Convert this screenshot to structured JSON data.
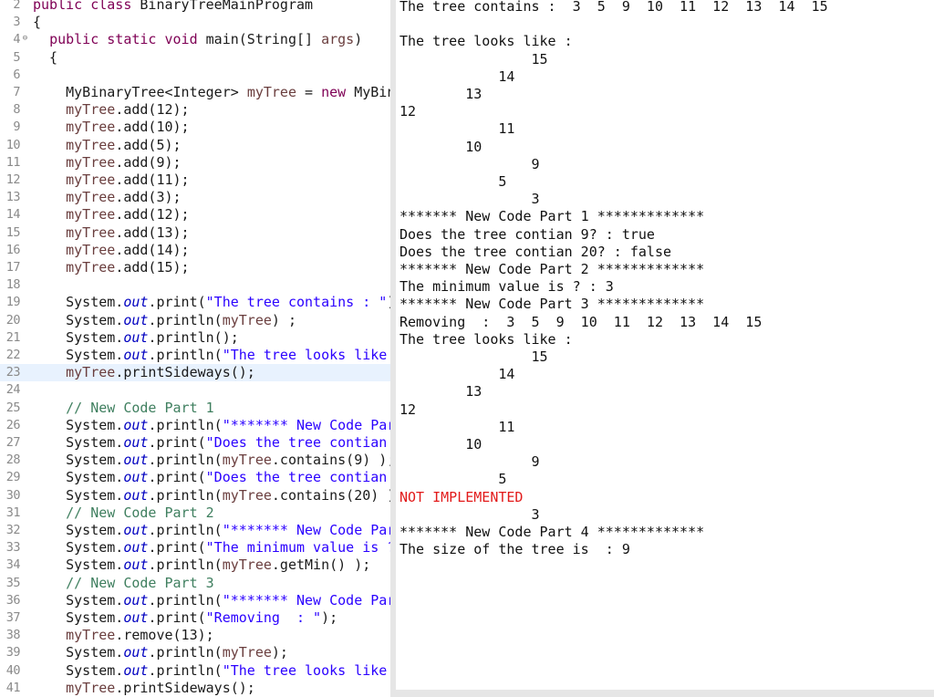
{
  "editor": {
    "lines": [
      {
        "n": "2",
        "tokens": [
          {
            "t": "kw",
            "v": "public"
          },
          {
            "t": "",
            "v": " "
          },
          {
            "t": "kw",
            "v": "class"
          },
          {
            "t": "",
            "v": " BinaryTreeMainProgram"
          }
        ]
      },
      {
        "n": "3",
        "tokens": [
          {
            "t": "",
            "v": "{"
          }
        ]
      },
      {
        "n": "4",
        "fold": true,
        "tokens": [
          {
            "t": "",
            "v": "  "
          },
          {
            "t": "kw",
            "v": "public"
          },
          {
            "t": "",
            "v": " "
          },
          {
            "t": "kw",
            "v": "static"
          },
          {
            "t": "",
            "v": " "
          },
          {
            "t": "kw",
            "v": "void"
          },
          {
            "t": "",
            "v": " main(String[] "
          },
          {
            "t": "var",
            "v": "args"
          },
          {
            "t": "",
            "v": ")"
          }
        ]
      },
      {
        "n": "5",
        "tokens": [
          {
            "t": "",
            "v": "  {"
          }
        ]
      },
      {
        "n": "6",
        "tokens": []
      },
      {
        "n": "7",
        "tokens": [
          {
            "t": "",
            "v": "    MyBinaryTree<Integer> "
          },
          {
            "t": "var",
            "v": "myTree"
          },
          {
            "t": "",
            "v": " = "
          },
          {
            "t": "kw",
            "v": "new"
          },
          {
            "t": "",
            "v": " MyBin"
          }
        ]
      },
      {
        "n": "8",
        "tokens": [
          {
            "t": "",
            "v": "    "
          },
          {
            "t": "var",
            "v": "myTree"
          },
          {
            "t": "",
            "v": ".add(12);"
          }
        ]
      },
      {
        "n": "9",
        "tokens": [
          {
            "t": "",
            "v": "    "
          },
          {
            "t": "var",
            "v": "myTree"
          },
          {
            "t": "",
            "v": ".add(10);"
          }
        ]
      },
      {
        "n": "10",
        "tokens": [
          {
            "t": "",
            "v": "    "
          },
          {
            "t": "var",
            "v": "myTree"
          },
          {
            "t": "",
            "v": ".add(5);"
          }
        ]
      },
      {
        "n": "11",
        "tokens": [
          {
            "t": "",
            "v": "    "
          },
          {
            "t": "var",
            "v": "myTree"
          },
          {
            "t": "",
            "v": ".add(9);"
          }
        ]
      },
      {
        "n": "12",
        "tokens": [
          {
            "t": "",
            "v": "    "
          },
          {
            "t": "var",
            "v": "myTree"
          },
          {
            "t": "",
            "v": ".add(11);"
          }
        ]
      },
      {
        "n": "13",
        "tokens": [
          {
            "t": "",
            "v": "    "
          },
          {
            "t": "var",
            "v": "myTree"
          },
          {
            "t": "",
            "v": ".add(3);"
          }
        ]
      },
      {
        "n": "14",
        "tokens": [
          {
            "t": "",
            "v": "    "
          },
          {
            "t": "var",
            "v": "myTree"
          },
          {
            "t": "",
            "v": ".add(12);"
          }
        ]
      },
      {
        "n": "15",
        "tokens": [
          {
            "t": "",
            "v": "    "
          },
          {
            "t": "var",
            "v": "myTree"
          },
          {
            "t": "",
            "v": ".add(13);"
          }
        ]
      },
      {
        "n": "16",
        "tokens": [
          {
            "t": "",
            "v": "    "
          },
          {
            "t": "var",
            "v": "myTree"
          },
          {
            "t": "",
            "v": ".add(14);"
          }
        ]
      },
      {
        "n": "17",
        "tokens": [
          {
            "t": "",
            "v": "    "
          },
          {
            "t": "var",
            "v": "myTree"
          },
          {
            "t": "",
            "v": ".add(15);"
          }
        ]
      },
      {
        "n": "18",
        "tokens": []
      },
      {
        "n": "19",
        "tokens": [
          {
            "t": "",
            "v": "    System."
          },
          {
            "t": "fld",
            "v": "out"
          },
          {
            "t": "",
            "v": ".print("
          },
          {
            "t": "str",
            "v": "\"The tree contains : \""
          },
          {
            "t": "",
            "v": ")"
          }
        ]
      },
      {
        "n": "20",
        "tokens": [
          {
            "t": "",
            "v": "    System."
          },
          {
            "t": "fld",
            "v": "out"
          },
          {
            "t": "",
            "v": ".println("
          },
          {
            "t": "var",
            "v": "myTree"
          },
          {
            "t": "",
            "v": ") ;"
          }
        ]
      },
      {
        "n": "21",
        "tokens": [
          {
            "t": "",
            "v": "    System."
          },
          {
            "t": "fld",
            "v": "out"
          },
          {
            "t": "",
            "v": ".println();"
          }
        ]
      },
      {
        "n": "22",
        "tokens": [
          {
            "t": "",
            "v": "    System."
          },
          {
            "t": "fld",
            "v": "out"
          },
          {
            "t": "",
            "v": ".println("
          },
          {
            "t": "str",
            "v": "\"The tree looks like"
          }
        ]
      },
      {
        "n": "23",
        "active": true,
        "tokens": [
          {
            "t": "",
            "v": "    "
          },
          {
            "t": "var",
            "v": "myTree"
          },
          {
            "t": "",
            "v": ".printSideways();"
          }
        ]
      },
      {
        "n": "24",
        "tokens": []
      },
      {
        "n": "25",
        "tokens": [
          {
            "t": "",
            "v": "    "
          },
          {
            "t": "com",
            "v": "// New Code Part 1"
          }
        ]
      },
      {
        "n": "26",
        "tokens": [
          {
            "t": "",
            "v": "    System."
          },
          {
            "t": "fld",
            "v": "out"
          },
          {
            "t": "",
            "v": ".println("
          },
          {
            "t": "str",
            "v": "\"******* New Code Par"
          }
        ]
      },
      {
        "n": "27",
        "tokens": [
          {
            "t": "",
            "v": "    System."
          },
          {
            "t": "fld",
            "v": "out"
          },
          {
            "t": "",
            "v": ".print("
          },
          {
            "t": "str",
            "v": "\"Does the tree contian '"
          }
        ]
      },
      {
        "n": "28",
        "tokens": [
          {
            "t": "",
            "v": "    System."
          },
          {
            "t": "fld",
            "v": "out"
          },
          {
            "t": "",
            "v": ".println("
          },
          {
            "t": "var",
            "v": "myTree"
          },
          {
            "t": "",
            "v": ".contains(9) );"
          }
        ]
      },
      {
        "n": "29",
        "tokens": [
          {
            "t": "",
            "v": "    System."
          },
          {
            "t": "fld",
            "v": "out"
          },
          {
            "t": "",
            "v": ".print("
          },
          {
            "t": "str",
            "v": "\"Does the tree contian :"
          }
        ]
      },
      {
        "n": "30",
        "tokens": [
          {
            "t": "",
            "v": "    System."
          },
          {
            "t": "fld",
            "v": "out"
          },
          {
            "t": "",
            "v": ".println("
          },
          {
            "t": "var",
            "v": "myTree"
          },
          {
            "t": "",
            "v": ".contains(20) )"
          }
        ]
      },
      {
        "n": "31",
        "tokens": [
          {
            "t": "",
            "v": "    "
          },
          {
            "t": "com",
            "v": "// New Code Part 2"
          }
        ]
      },
      {
        "n": "32",
        "tokens": [
          {
            "t": "",
            "v": "    System."
          },
          {
            "t": "fld",
            "v": "out"
          },
          {
            "t": "",
            "v": ".println("
          },
          {
            "t": "str",
            "v": "\"******* New Code Par"
          }
        ]
      },
      {
        "n": "33",
        "tokens": [
          {
            "t": "",
            "v": "    System."
          },
          {
            "t": "fld",
            "v": "out"
          },
          {
            "t": "",
            "v": ".print("
          },
          {
            "t": "str",
            "v": "\"The minimum value is ?"
          }
        ]
      },
      {
        "n": "34",
        "tokens": [
          {
            "t": "",
            "v": "    System."
          },
          {
            "t": "fld",
            "v": "out"
          },
          {
            "t": "",
            "v": ".println("
          },
          {
            "t": "var",
            "v": "myTree"
          },
          {
            "t": "",
            "v": ".getMin() );"
          }
        ]
      },
      {
        "n": "35",
        "tokens": [
          {
            "t": "",
            "v": "    "
          },
          {
            "t": "com",
            "v": "// New Code Part 3"
          }
        ]
      },
      {
        "n": "36",
        "tokens": [
          {
            "t": "",
            "v": "    System."
          },
          {
            "t": "fld",
            "v": "out"
          },
          {
            "t": "",
            "v": ".println("
          },
          {
            "t": "str",
            "v": "\"******* New Code Par"
          }
        ]
      },
      {
        "n": "37",
        "tokens": [
          {
            "t": "",
            "v": "    System."
          },
          {
            "t": "fld",
            "v": "out"
          },
          {
            "t": "",
            "v": ".print("
          },
          {
            "t": "str",
            "v": "\"Removing  : \""
          },
          {
            "t": "",
            "v": ");"
          }
        ]
      },
      {
        "n": "38",
        "tokens": [
          {
            "t": "",
            "v": "    "
          },
          {
            "t": "var",
            "v": "myTree"
          },
          {
            "t": "",
            "v": ".remove(13);"
          }
        ]
      },
      {
        "n": "39",
        "tokens": [
          {
            "t": "",
            "v": "    System."
          },
          {
            "t": "fld",
            "v": "out"
          },
          {
            "t": "",
            "v": ".println("
          },
          {
            "t": "var",
            "v": "myTree"
          },
          {
            "t": "",
            "v": ");"
          }
        ]
      },
      {
        "n": "40",
        "tokens": [
          {
            "t": "",
            "v": "    System."
          },
          {
            "t": "fld",
            "v": "out"
          },
          {
            "t": "",
            "v": ".println("
          },
          {
            "t": "str",
            "v": "\"The tree looks like"
          }
        ]
      },
      {
        "n": "41",
        "tokens": [
          {
            "t": "",
            "v": "    "
          },
          {
            "t": "var",
            "v": "myTree"
          },
          {
            "t": "",
            "v": ".printSideways();"
          }
        ]
      }
    ]
  },
  "console": {
    "lines": [
      {
        "text": "The tree contains :  3  5  9  10  11  12  13  14  15"
      },
      {
        "text": ""
      },
      {
        "text": "The tree looks like :"
      },
      {
        "text": "                15"
      },
      {
        "text": "            14"
      },
      {
        "text": "        13"
      },
      {
        "text": "12"
      },
      {
        "text": "            11"
      },
      {
        "text": "        10"
      },
      {
        "text": "                9"
      },
      {
        "text": "            5"
      },
      {
        "text": "                3"
      },
      {
        "text": "******* New Code Part 1 *************"
      },
      {
        "text": "Does the tree contian 9? : true"
      },
      {
        "text": "Does the tree contian 20? : false"
      },
      {
        "text": "******* New Code Part 2 *************"
      },
      {
        "text": "The minimum value is ? : 3"
      },
      {
        "text": "******* New Code Part 3 *************"
      },
      {
        "text": "Removing  :  3  5  9  10  11  12  13  14  15"
      },
      {
        "text": "The tree looks like :"
      },
      {
        "text": "                15"
      },
      {
        "text": "            14"
      },
      {
        "text": "        13"
      },
      {
        "text": "12"
      },
      {
        "text": "            11"
      },
      {
        "text": "        10"
      },
      {
        "text": "                9"
      },
      {
        "text": "            5"
      },
      {
        "text": "NOT IMPLEMENTED",
        "error": true
      },
      {
        "text": "                3"
      },
      {
        "text": "******* New Code Part 4 *************"
      },
      {
        "text": "The size of the tree is  : 9"
      }
    ]
  }
}
